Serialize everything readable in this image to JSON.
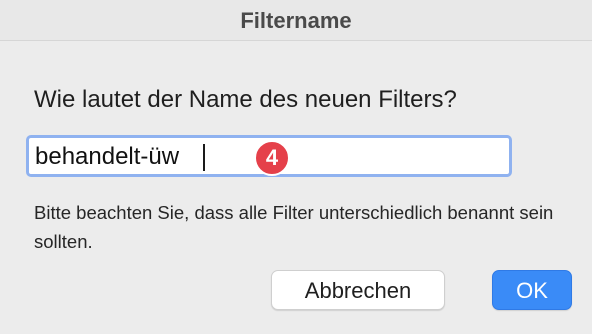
{
  "dialog": {
    "title": "Filtername",
    "question": "Wie lautet der Name des neuen Filters?",
    "input": {
      "value": "behandelt-üw"
    },
    "badge": "4",
    "hint": "Bitte beachten Sie, dass alle Filter unterschiedlich benannt sein sollten.",
    "cancel_label": "Abbrechen",
    "ok_label": "OK"
  },
  "colors": {
    "accent": "#3a8bf7",
    "focus_ring": "#8fb2f0",
    "badge": "#e5404a",
    "background": "#ececec"
  }
}
